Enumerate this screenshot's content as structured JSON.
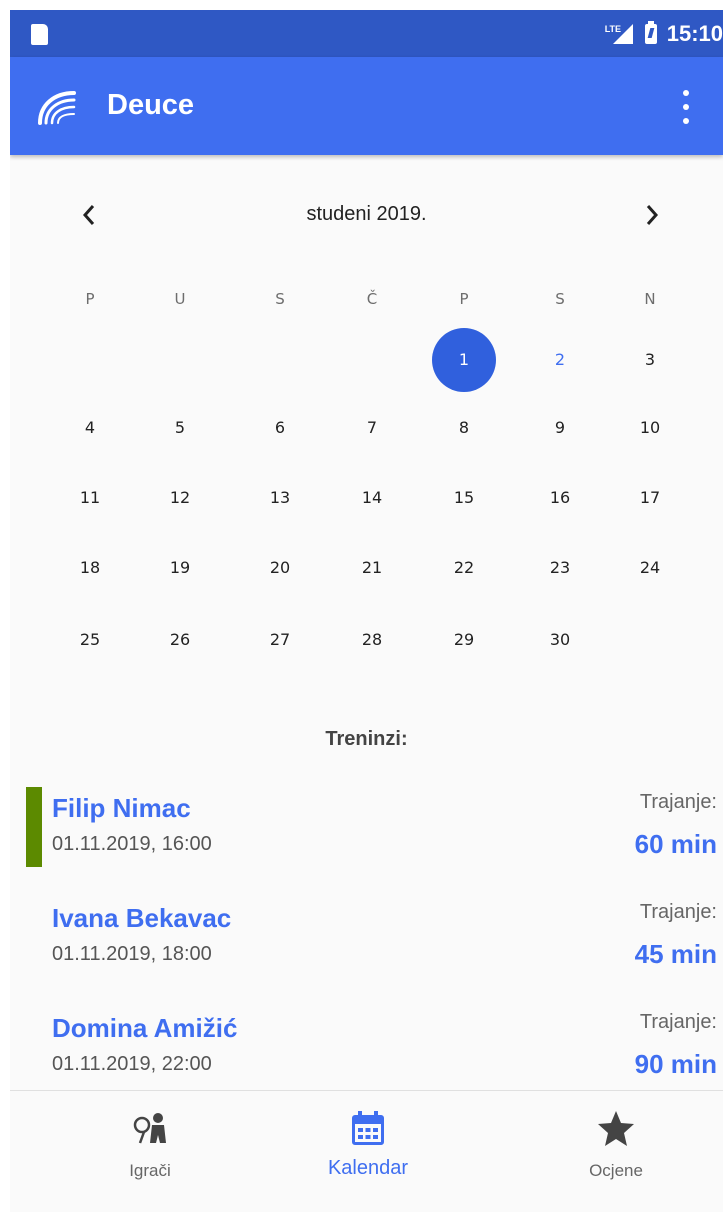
{
  "status_bar": {
    "network": "LTE",
    "time": "15:10"
  },
  "app_bar": {
    "title": "Deuce",
    "logo_icon": "deuce-logo-icon",
    "overflow_icon": "more-vert-icon"
  },
  "calendar": {
    "prev_icon": "chevron-left-icon",
    "next_icon": "chevron-right-icon",
    "month_label": "studeni 2019.",
    "weekdays": [
      "P",
      "U",
      "S",
      "Č",
      "P",
      "S",
      "N"
    ],
    "weeks": [
      [
        "",
        "",
        "",
        "",
        "1",
        "2",
        "3"
      ],
      [
        "4",
        "5",
        "6",
        "7",
        "8",
        "9",
        "10"
      ],
      [
        "11",
        "12",
        "13",
        "14",
        "15",
        "16",
        "17"
      ],
      [
        "18",
        "19",
        "20",
        "21",
        "22",
        "23",
        "24"
      ],
      [
        "25",
        "26",
        "27",
        "28",
        "29",
        "30",
        ""
      ]
    ],
    "selected_day": "1",
    "today_day": "2"
  },
  "trainings": {
    "title": "Treninzi:",
    "items": [
      {
        "name": "Filip Nimac",
        "datetime": "01.11.2019, 16:00",
        "duration_label": "Trajanje:",
        "duration": "60 min",
        "highlighted": true
      },
      {
        "name": "Ivana Bekavac",
        "datetime": "01.11.2019, 18:00",
        "duration_label": "Trajanje:",
        "duration": "45 min",
        "highlighted": false
      },
      {
        "name": "Domina Amižić",
        "datetime": "01.11.2019, 22:00",
        "duration_label": "Trajanje:",
        "duration": "90 min",
        "highlighted": false
      }
    ]
  },
  "bottom_nav": {
    "tabs": [
      {
        "label": "Igrači",
        "icon": "player-icon",
        "active": false
      },
      {
        "label": "Kalendar",
        "icon": "calendar-icon",
        "active": true
      },
      {
        "label": "Ocjene",
        "icon": "star-icon",
        "active": false
      }
    ]
  },
  "colors": {
    "primary": "#3f6ef0",
    "primary_dark": "#2f58c4",
    "selected_day": "#3060dd",
    "highlight_bar": "#5c8a00"
  }
}
